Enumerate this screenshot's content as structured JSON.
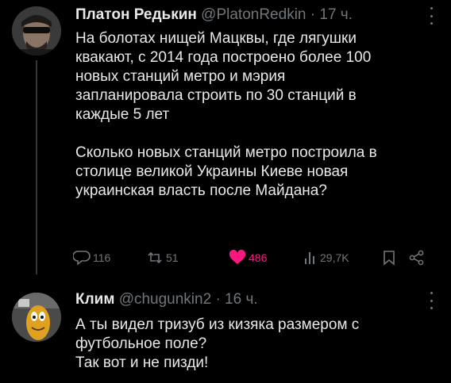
{
  "tweets": [
    {
      "author": {
        "display_name": "Платон Редькин",
        "handle": "@PlatonRedkin",
        "time": "· 17 ч."
      },
      "paragraphs": [
        "На болотах нищей Мацквы, где лягушки\nквакают, с 2014 года построено более 100\nновых станций метро и мэрия\nзапланировала строить по 30 станций в\nкаждые 5 лет",
        "Сколько новых станций метро построила в\nстолице великой Украины Киеве новая\nукраинская власть после Майдана?"
      ],
      "stats": {
        "replies": "116",
        "reposts": "51",
        "likes": "486",
        "views": "29,7K"
      }
    },
    {
      "author": {
        "display_name": "Клим",
        "handle": "@chugunkin2",
        "time": "· 16 ч."
      },
      "paragraphs": [
        "А ты видел тризуб из кизяка размером с\nфутбольное поле?\nТак вот и не пизди!"
      ]
    }
  ],
  "icons": {
    "reply": "speech-bubble-icon",
    "repost": "repost-arrows-icon",
    "like": "heart-icon",
    "views": "bar-chart-icon",
    "bookmark": "bookmark-icon",
    "share": "share-icon"
  },
  "colors": {
    "background": "#000000",
    "text": "#e7e9ea",
    "muted": "#71767b",
    "like_active": "#f91880"
  }
}
